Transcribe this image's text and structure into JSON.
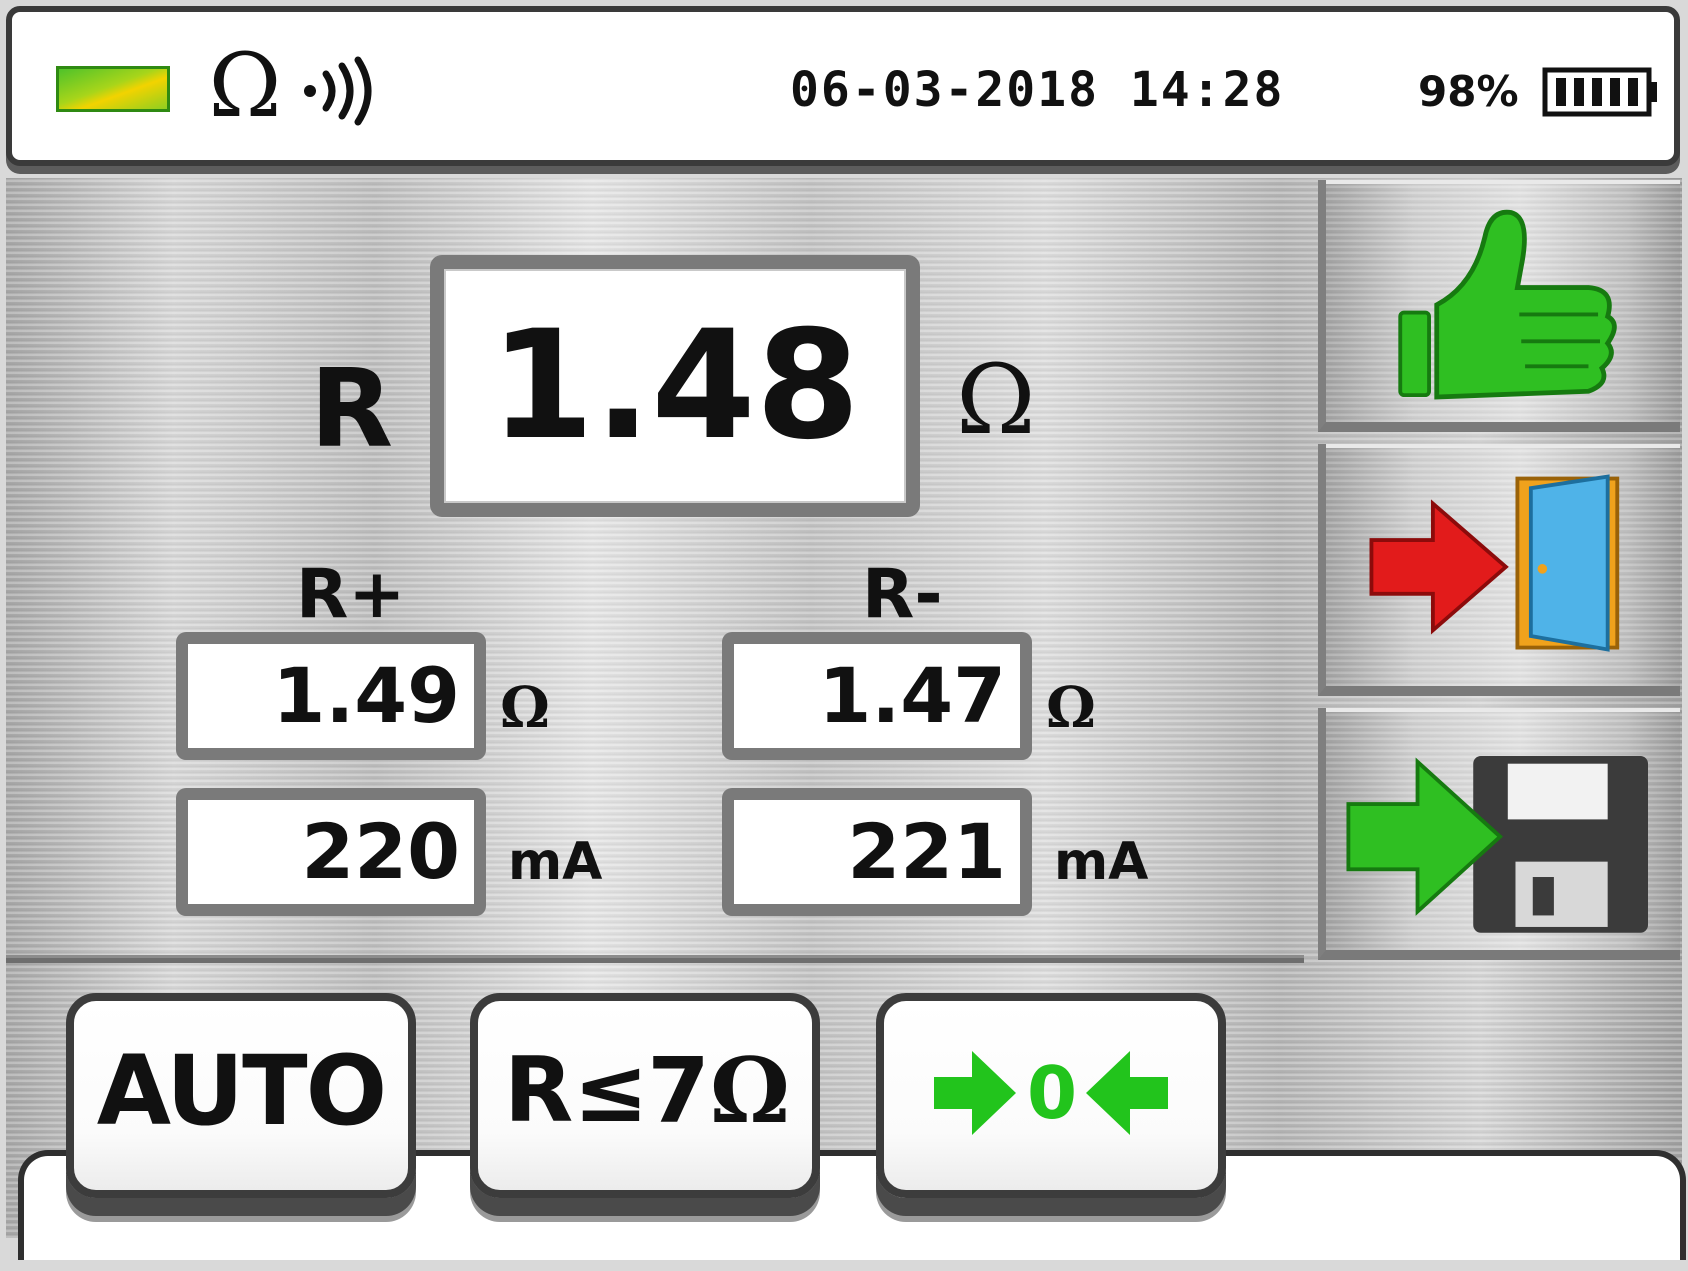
{
  "status_bar": {
    "mode_symbol": "Ω",
    "datetime": "06-03-2018 14:28",
    "battery_percent": "98%",
    "icons": [
      "status-indicator-icon",
      "omega-icon",
      "beeper-icon",
      "battery-icon"
    ],
    "indicator_colors": [
      "#4fc22a",
      "#f2d300"
    ]
  },
  "main_reading": {
    "label": "R",
    "value": "1.48",
    "unit": "Ω"
  },
  "positive": {
    "label": "R+",
    "resistance": "1.49",
    "resistance_unit": "Ω",
    "current": "220",
    "current_unit": "mA"
  },
  "negative": {
    "label": "R-",
    "resistance": "1.47",
    "resistance_unit": "Ω",
    "current": "221",
    "current_unit": "mA"
  },
  "side_buttons": [
    {
      "icon": "thumbs-up-icon",
      "color": "#2fbf22"
    },
    {
      "icon": "exit-door-icon",
      "color": "#e21b1b"
    },
    {
      "icon": "save-floppy-icon",
      "color": "#2fbf22"
    }
  ],
  "bottom_buttons": {
    "auto_label": "AUTO",
    "range_symbol": "R≤",
    "range_value": "7",
    "range_unit": "Ω",
    "zero_label": "0",
    "zero_color": "#22c41c"
  }
}
